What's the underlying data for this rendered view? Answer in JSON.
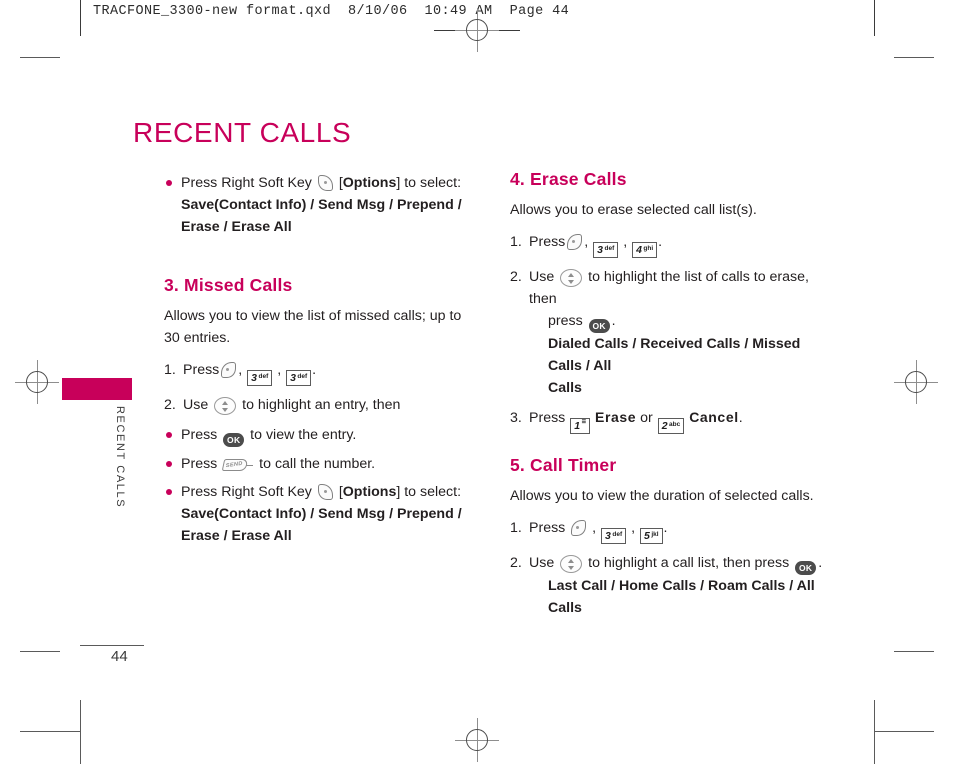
{
  "prepress": {
    "slug": "TRACFONE_3300-new format.qxd  8/10/06  10:49 AM  Page 44"
  },
  "side_tab": {
    "label": "RECENT CALLS",
    "color": "#c8005a"
  },
  "page": {
    "title": "RECENT CALLS",
    "number": "44",
    "accent_color": "#c8005a"
  },
  "left_column": {
    "top_bullet": {
      "press": "Press Right Soft Key",
      "bracket_open": "[",
      "options_label": "Options",
      "bracket_close": "] to select:",
      "menu_line_1": "Save(Contact Info) / Send Msg / Prepend /",
      "menu_line_2": "Erase / Erase All"
    },
    "section": {
      "heading": "3. Missed Calls",
      "intro": "Allows you to view the list of missed calls; up to 30 entries.",
      "step1": {
        "num": "1.",
        "verb": "Press",
        "keys": [
          "soft-key",
          "3 def",
          "3 def"
        ],
        "period": "."
      },
      "step2": {
        "num": "2.",
        "pre": "Use",
        "post": "to highlight an entry, then"
      },
      "bullets": [
        {
          "pre": "Press",
          "icon": "ok-key",
          "post": "to view the entry."
        },
        {
          "pre": "Press",
          "icon": "send-key",
          "post": "to call the number."
        }
      ],
      "options_bullet": {
        "press": "Press Right Soft Key",
        "bracket_open": "[",
        "options_label": "Options",
        "bracket_close": "] to select:",
        "menu_line_1": "Save(Contact Info) / Send Msg / Prepend /",
        "menu_line_2": "Erase / Erase All"
      }
    }
  },
  "right_column": {
    "erase_calls": {
      "heading": "4. Erase Calls",
      "intro": "Allows you to erase selected call list(s).",
      "step1": {
        "num": "1.",
        "verb": "Press",
        "keys": [
          "soft-key",
          "3 def",
          "4 ghi"
        ],
        "period": "."
      },
      "step2": {
        "num": "2.",
        "pre": "Use",
        "mid": "to highlight the list of calls to erase, then",
        "post": "press",
        "period": ".",
        "menu_line_1": "Dialed Calls / Received Calls / Missed Calls / All",
        "menu_line_2": "Calls"
      },
      "step3": {
        "num": "3.",
        "verb": "Press",
        "key1_num": "1",
        "key1_sub": "☰",
        "word1": "Erase",
        "conj": "or",
        "key2_num": "2",
        "key2_sub": "abc",
        "word2": "Cancel",
        "period": "."
      }
    },
    "call_timer": {
      "heading": "5. Call Timer",
      "intro": "Allows you to view the duration of selected calls.",
      "step1": {
        "num": "1.",
        "verb": "Press",
        "keys": [
          "soft-key",
          "3 def",
          "5 jkl"
        ],
        "period": "."
      },
      "step2": {
        "num": "2.",
        "pre": "Use",
        "mid": "to highlight a call list, then press",
        "period": ".",
        "menu_line": "Last Call / Home Calls / Roam Calls / All Calls"
      }
    }
  },
  "keys": {
    "k3def": {
      "num": "3",
      "sub": "def"
    },
    "k4ghi": {
      "num": "4",
      "sub": "ghi"
    },
    "k5jkl": {
      "num": "5",
      "sub": "jkl"
    },
    "ok": "OK"
  }
}
